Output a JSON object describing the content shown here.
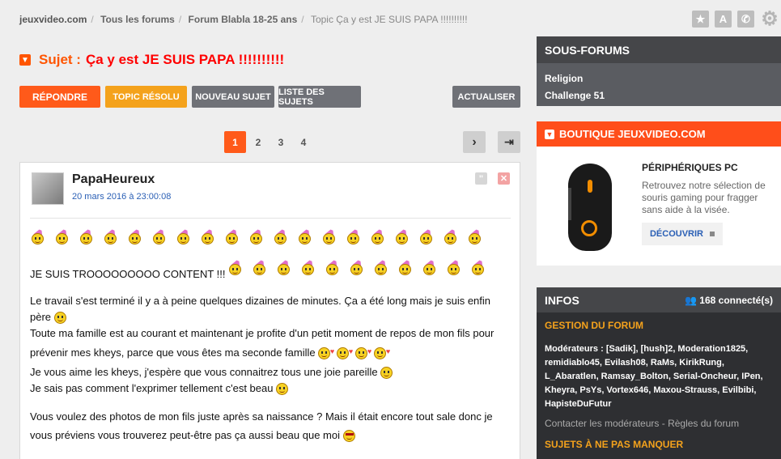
{
  "breadcrumb": [
    "jeuxvideo.com",
    "Tous les forums",
    "Forum Blabla 18-25 ans",
    "Topic Ça y est JE SUIS PAPA !!!!!!!!!!"
  ],
  "topic": {
    "label": "Sujet :",
    "title": "Ça y est JE SUIS PAPA !!!!!!!!!!"
  },
  "buttons": {
    "reply": "RÉPONDRE",
    "resolved": "TOPIC RÉSOLU",
    "new_topic": "NOUVEAU SUJET",
    "list": "LISTE DES SUJETS",
    "refresh": "ACTUALISER"
  },
  "pagination": {
    "pages": [
      "1",
      "2",
      "3",
      "4"
    ],
    "current": "1",
    "next": "›",
    "last": "⇥"
  },
  "post": {
    "author": "PapaHeureux",
    "date": "20 mars 2016 à 23:00:08",
    "quote_icon": "\"",
    "close_icon": "✕",
    "line1": "JE SUIS TROOOOOOOOO CONTENT !!!",
    "line2": "Le travail s'est terminé il y a à peine quelques dizaines de minutes. Ça a été long mais je suis enfin",
    "line2b": "père",
    "line3": "Toute ma famille est au courant et maintenant je profite d'un petit moment de repos de mon fils pour",
    "line3b": "prévenir mes kheys, parce que vous êtes ma seconde famille",
    "line4": "Je vous aime les kheys, j'espère que vous connaitrez tous une joie pareille",
    "line5": "Je sais pas comment l'exprimer tellement c'est beau",
    "line6": "Vous voulez des photos de mon fils juste après sa naissance ? Mais il était encore tout sale donc je",
    "line6b": "vous préviens vous trouverez peut-être pas ça aussi beau que moi"
  },
  "sous_forums": {
    "title": "SOUS-FORUMS",
    "items": [
      "Religion",
      "Challenge 51"
    ]
  },
  "boutique": {
    "title": "BOUTIQUE JEUXVIDEO.COM",
    "product": "PÉRIPHÉRIQUES PC",
    "desc": "Retrouvez notre sélection de souris gaming pour fragger sans aide à la visée.",
    "cta": "DÉCOUVRIR"
  },
  "infos": {
    "title": "INFOS",
    "connected": "168 connecté(s)",
    "gestion": "GESTION DU FORUM",
    "mods_label": "Modérateurs :",
    "mods": "[Sadik], [hush]2, Moderation1825, remidiablo45, Evilash08, RaMs, KirikRung, L_Abaratlen, Ramsay_Bolton, Serial-Oncheur, IPen, Kheyra, PsYs, Vortex646, Maxou-Strauss, Evilbibi, HapisteDuFutur",
    "contact": "Contacter les modérateurs - Règles du forum",
    "sujets": "SUJETS À NE PAS MANQUER"
  },
  "top_icons": [
    "star-icon",
    "translate-icon",
    "phone-icon",
    "gear-icon"
  ]
}
